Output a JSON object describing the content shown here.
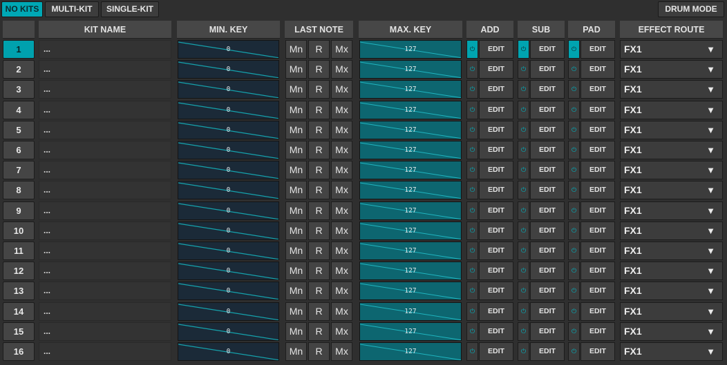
{
  "top_buttons": {
    "no_kits": "NO KITS",
    "multi_kit": "MULTI-KIT",
    "single_kit": "SINGLE-KIT",
    "drum_mode": "DRUM MODE"
  },
  "headers": {
    "kit_name": "KIT NAME",
    "min_key": "MIN. KEY",
    "last_note": "LAST NOTE",
    "max_key": "MAX. KEY",
    "add": "ADD",
    "sub": "SUB",
    "pad": "PAD",
    "effect_route": "EFFECT ROUTE"
  },
  "last_note_options": [
    "Mn",
    "R",
    "Mx"
  ],
  "edit_label": "EDIT",
  "power_icon": "power-icon",
  "dropdown_icon": "chevron-down-icon",
  "colors": {
    "accent": "#00a8b5",
    "max_key_fill": "#0d6670",
    "min_key_fill": "#1b2a38"
  },
  "rows": [
    {
      "num": "1",
      "name": "...",
      "min": "0",
      "max": "127",
      "route": "FX1",
      "selected": true,
      "add_on": true,
      "sub_on": true,
      "pad_on": true
    },
    {
      "num": "2",
      "name": "...",
      "min": "0",
      "max": "127",
      "route": "FX1",
      "selected": false,
      "add_on": false,
      "sub_on": false,
      "pad_on": false
    },
    {
      "num": "3",
      "name": "...",
      "min": "0",
      "max": "127",
      "route": "FX1",
      "selected": false,
      "add_on": false,
      "sub_on": false,
      "pad_on": false
    },
    {
      "num": "4",
      "name": "...",
      "min": "0",
      "max": "127",
      "route": "FX1",
      "selected": false,
      "add_on": false,
      "sub_on": false,
      "pad_on": false
    },
    {
      "num": "5",
      "name": "...",
      "min": "0",
      "max": "127",
      "route": "FX1",
      "selected": false,
      "add_on": false,
      "sub_on": false,
      "pad_on": false
    },
    {
      "num": "6",
      "name": "...",
      "min": "0",
      "max": "127",
      "route": "FX1",
      "selected": false,
      "add_on": false,
      "sub_on": false,
      "pad_on": false
    },
    {
      "num": "7",
      "name": "...",
      "min": "0",
      "max": "127",
      "route": "FX1",
      "selected": false,
      "add_on": false,
      "sub_on": false,
      "pad_on": false
    },
    {
      "num": "8",
      "name": "...",
      "min": "0",
      "max": "127",
      "route": "FX1",
      "selected": false,
      "add_on": false,
      "sub_on": false,
      "pad_on": false
    },
    {
      "num": "9",
      "name": "...",
      "min": "0",
      "max": "127",
      "route": "FX1",
      "selected": false,
      "add_on": false,
      "sub_on": false,
      "pad_on": false
    },
    {
      "num": "10",
      "name": "...",
      "min": "0",
      "max": "127",
      "route": "FX1",
      "selected": false,
      "add_on": false,
      "sub_on": false,
      "pad_on": false
    },
    {
      "num": "11",
      "name": "...",
      "min": "0",
      "max": "127",
      "route": "FX1",
      "selected": false,
      "add_on": false,
      "sub_on": false,
      "pad_on": false
    },
    {
      "num": "12",
      "name": "...",
      "min": "0",
      "max": "127",
      "route": "FX1",
      "selected": false,
      "add_on": false,
      "sub_on": false,
      "pad_on": false
    },
    {
      "num": "13",
      "name": "...",
      "min": "0",
      "max": "127",
      "route": "FX1",
      "selected": false,
      "add_on": false,
      "sub_on": false,
      "pad_on": false
    },
    {
      "num": "14",
      "name": "...",
      "min": "0",
      "max": "127",
      "route": "FX1",
      "selected": false,
      "add_on": false,
      "sub_on": false,
      "pad_on": false
    },
    {
      "num": "15",
      "name": "...",
      "min": "0",
      "max": "127",
      "route": "FX1",
      "selected": false,
      "add_on": false,
      "sub_on": false,
      "pad_on": false
    },
    {
      "num": "16",
      "name": "...",
      "min": "0",
      "max": "127",
      "route": "FX1",
      "selected": false,
      "add_on": false,
      "sub_on": false,
      "pad_on": false
    }
  ]
}
